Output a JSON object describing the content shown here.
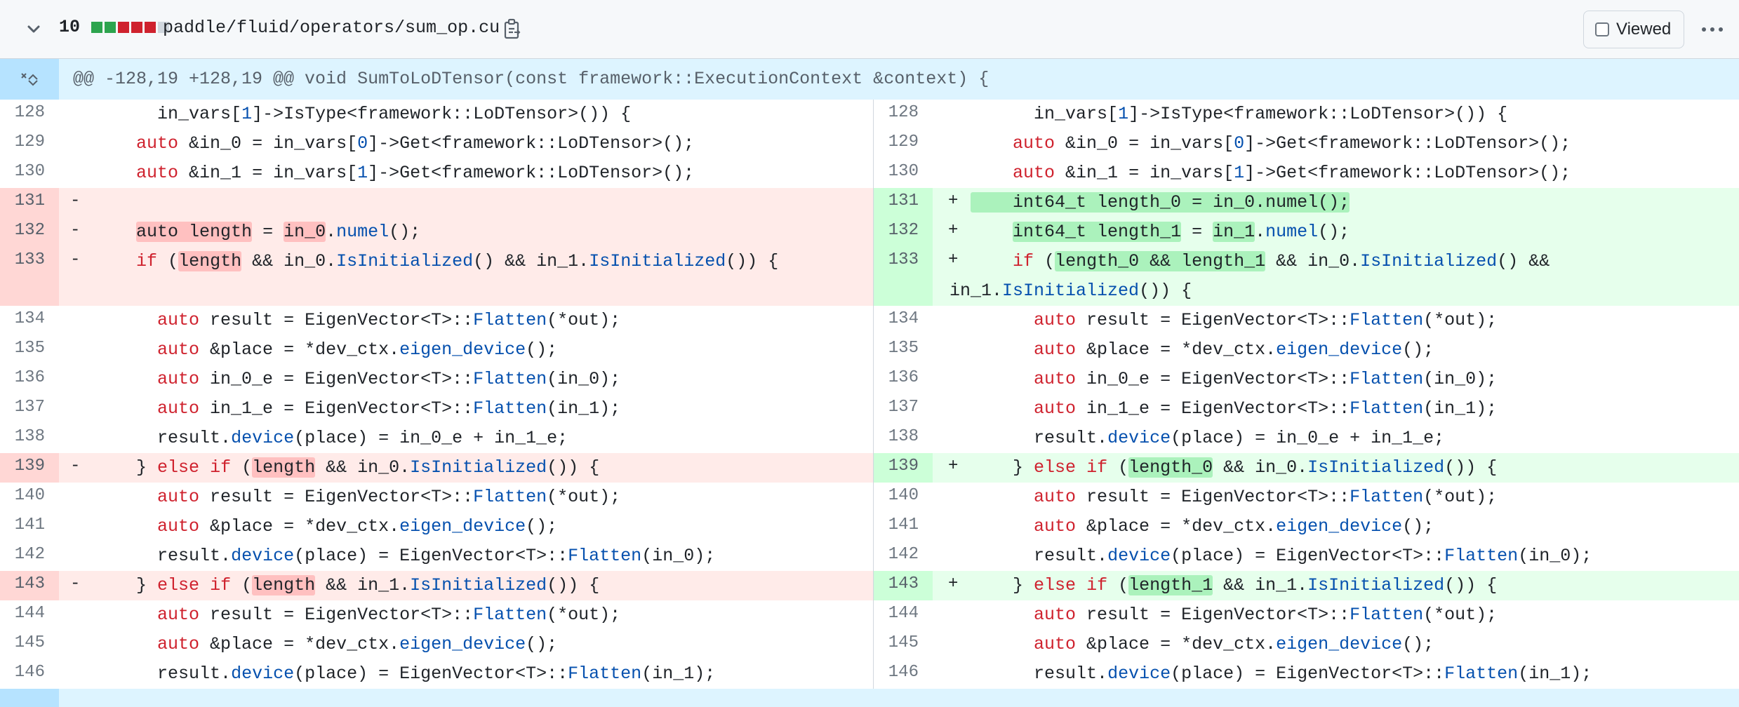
{
  "file": {
    "changes_count": "10",
    "path": "paddle/fluid/operators/sum_op.cu",
    "diffstat": [
      "#2da44e",
      "#2da44e",
      "#cf222e",
      "#cf222e",
      "#cf222e",
      "#d0d7de"
    ],
    "viewed_label": "Viewed"
  },
  "hunk": {
    "header": "@@ -128,19 +128,19 @@ void SumToLoDTensor(const framework::ExecutionContext &context) {"
  },
  "rows": [
    {
      "type": "ctx",
      "ln": "128",
      "rn": "128",
      "l": [
        [
          "      in_vars[",
          ""
        ],
        [
          "1",
          "nb"
        ],
        [
          "]->IsType<framework::LoDTensor>()) {",
          ""
        ]
      ],
      "r": [
        [
          "      in_vars[",
          ""
        ],
        [
          "1",
          "nb"
        ],
        [
          "]->IsType<framework::LoDTensor>()) {",
          ""
        ]
      ]
    },
    {
      "type": "ctx",
      "ln": "129",
      "rn": "129",
      "l": [
        [
          "    ",
          ""
        ],
        [
          "auto",
          "kw"
        ],
        [
          " &in_0 = in_vars[",
          ""
        ],
        [
          "0",
          "nb"
        ],
        [
          "]->Get<framework::LoDTensor>();",
          ""
        ]
      ],
      "r": [
        [
          "    ",
          ""
        ],
        [
          "auto",
          "kw"
        ],
        [
          " &in_0 = in_vars[",
          ""
        ],
        [
          "0",
          "nb"
        ],
        [
          "]->Get<framework::LoDTensor>();",
          ""
        ]
      ]
    },
    {
      "type": "ctx",
      "ln": "130",
      "rn": "130",
      "l": [
        [
          "    ",
          ""
        ],
        [
          "auto",
          "kw"
        ],
        [
          " &in_1 = in_vars[",
          ""
        ],
        [
          "1",
          "nb"
        ],
        [
          "]->Get<framework::LoDTensor>();",
          ""
        ]
      ],
      "r": [
        [
          "    ",
          ""
        ],
        [
          "auto",
          "kw"
        ],
        [
          " &in_1 = in_vars[",
          ""
        ],
        [
          "1",
          "nb"
        ],
        [
          "]->Get<framework::LoDTensor>();",
          ""
        ]
      ]
    },
    {
      "type": "chg",
      "ln": "131",
      "rn": "131",
      "lm": "-",
      "rm": "+",
      "l": [],
      "r": [
        [
          "",
          "hl-add-lead"
        ],
        [
          "    int64_t length_0 = in_0.numel();",
          "hl-add"
        ]
      ]
    },
    {
      "type": "chg",
      "ln": "132",
      "rn": "132",
      "lm": "-",
      "rm": "+",
      "l": [
        [
          "    ",
          ""
        ],
        [
          "auto length",
          "hl-del"
        ],
        [
          " = ",
          ""
        ],
        [
          "in_0",
          "hl-del"
        ],
        [
          ".",
          ""
        ],
        [
          "numel",
          "fn"
        ],
        [
          "();",
          ""
        ]
      ],
      "r": [
        [
          "    ",
          ""
        ],
        [
          "int64_t length_1",
          "hl-add"
        ],
        [
          " = ",
          ""
        ],
        [
          "in_1",
          "hl-add"
        ],
        [
          ".",
          ""
        ],
        [
          "numel",
          "fn"
        ],
        [
          "();",
          ""
        ]
      ]
    },
    {
      "type": "chg",
      "tall": true,
      "ln": "133",
      "rn": "133",
      "lm": "-",
      "rm": "+",
      "l": [
        [
          "    ",
          ""
        ],
        [
          "if",
          "kw"
        ],
        [
          " (",
          ""
        ],
        [
          "length",
          "hl-del"
        ],
        [
          " && in_0.",
          ""
        ],
        [
          "IsInitialized",
          "fn"
        ],
        [
          "() && in_1.",
          ""
        ],
        [
          "IsInitialized",
          "fn"
        ],
        [
          "()) {",
          ""
        ]
      ],
      "r": [
        [
          "    ",
          ""
        ],
        [
          "if",
          "kw"
        ],
        [
          " (",
          ""
        ],
        [
          "length_0 && length_1",
          "hl-add"
        ],
        [
          " && in_0.",
          ""
        ],
        [
          "IsInitialized",
          "fn"
        ],
        [
          "() && in_1.",
          ""
        ],
        [
          "IsInitialized",
          "fn"
        ],
        [
          "()) {",
          ""
        ]
      ]
    },
    {
      "type": "ctx",
      "ln": "134",
      "rn": "134",
      "l": [
        [
          "      ",
          ""
        ],
        [
          "auto",
          "kw"
        ],
        [
          " result = EigenVector<T>::",
          ""
        ],
        [
          "Flatten",
          "fn"
        ],
        [
          "(*out);",
          ""
        ]
      ],
      "r": [
        [
          "      ",
          ""
        ],
        [
          "auto",
          "kw"
        ],
        [
          " result = EigenVector<T>::",
          ""
        ],
        [
          "Flatten",
          "fn"
        ],
        [
          "(*out);",
          ""
        ]
      ]
    },
    {
      "type": "ctx",
      "ln": "135",
      "rn": "135",
      "l": [
        [
          "      ",
          ""
        ],
        [
          "auto",
          "kw"
        ],
        [
          " &place = *dev_ctx.",
          ""
        ],
        [
          "eigen_device",
          "fn"
        ],
        [
          "();",
          ""
        ]
      ],
      "r": [
        [
          "      ",
          ""
        ],
        [
          "auto",
          "kw"
        ],
        [
          " &place = *dev_ctx.",
          ""
        ],
        [
          "eigen_device",
          "fn"
        ],
        [
          "();",
          ""
        ]
      ]
    },
    {
      "type": "ctx",
      "ln": "136",
      "rn": "136",
      "l": [
        [
          "      ",
          ""
        ],
        [
          "auto",
          "kw"
        ],
        [
          " in_0_e = EigenVector<T>::",
          ""
        ],
        [
          "Flatten",
          "fn"
        ],
        [
          "(in_0);",
          ""
        ]
      ],
      "r": [
        [
          "      ",
          ""
        ],
        [
          "auto",
          "kw"
        ],
        [
          " in_0_e = EigenVector<T>::",
          ""
        ],
        [
          "Flatten",
          "fn"
        ],
        [
          "(in_0);",
          ""
        ]
      ]
    },
    {
      "type": "ctx",
      "ln": "137",
      "rn": "137",
      "l": [
        [
          "      ",
          ""
        ],
        [
          "auto",
          "kw"
        ],
        [
          " in_1_e = EigenVector<T>::",
          ""
        ],
        [
          "Flatten",
          "fn"
        ],
        [
          "(in_1);",
          ""
        ]
      ],
      "r": [
        [
          "      ",
          ""
        ],
        [
          "auto",
          "kw"
        ],
        [
          " in_1_e = EigenVector<T>::",
          ""
        ],
        [
          "Flatten",
          "fn"
        ],
        [
          "(in_1);",
          ""
        ]
      ]
    },
    {
      "type": "ctx",
      "ln": "138",
      "rn": "138",
      "l": [
        [
          "      result.",
          ""
        ],
        [
          "device",
          "fn"
        ],
        [
          "(place) = in_0_e + in_1_e;",
          ""
        ]
      ],
      "r": [
        [
          "      result.",
          ""
        ],
        [
          "device",
          "fn"
        ],
        [
          "(place) = in_0_e + in_1_e;",
          ""
        ]
      ]
    },
    {
      "type": "chg",
      "ln": "139",
      "rn": "139",
      "lm": "-",
      "rm": "+",
      "l": [
        [
          "    } ",
          ""
        ],
        [
          "else",
          "kw"
        ],
        [
          " ",
          ""
        ],
        [
          "if",
          "kw"
        ],
        [
          " (",
          ""
        ],
        [
          "length",
          "hl-del"
        ],
        [
          " && in_0.",
          ""
        ],
        [
          "IsInitialized",
          "fn"
        ],
        [
          "()) {",
          ""
        ]
      ],
      "r": [
        [
          "    } ",
          ""
        ],
        [
          "else",
          "kw"
        ],
        [
          " ",
          ""
        ],
        [
          "if",
          "kw"
        ],
        [
          " (",
          ""
        ],
        [
          "length_0",
          "hl-add"
        ],
        [
          " && in_0.",
          ""
        ],
        [
          "IsInitialized",
          "fn"
        ],
        [
          "()) {",
          ""
        ]
      ]
    },
    {
      "type": "ctx",
      "ln": "140",
      "rn": "140",
      "l": [
        [
          "      ",
          ""
        ],
        [
          "auto",
          "kw"
        ],
        [
          " result = EigenVector<T>::",
          ""
        ],
        [
          "Flatten",
          "fn"
        ],
        [
          "(*out);",
          ""
        ]
      ],
      "r": [
        [
          "      ",
          ""
        ],
        [
          "auto",
          "kw"
        ],
        [
          " result = EigenVector<T>::",
          ""
        ],
        [
          "Flatten",
          "fn"
        ],
        [
          "(*out);",
          ""
        ]
      ]
    },
    {
      "type": "ctx",
      "ln": "141",
      "rn": "141",
      "l": [
        [
          "      ",
          ""
        ],
        [
          "auto",
          "kw"
        ],
        [
          " &place = *dev_ctx.",
          ""
        ],
        [
          "eigen_device",
          "fn"
        ],
        [
          "();",
          ""
        ]
      ],
      "r": [
        [
          "      ",
          ""
        ],
        [
          "auto",
          "kw"
        ],
        [
          " &place = *dev_ctx.",
          ""
        ],
        [
          "eigen_device",
          "fn"
        ],
        [
          "();",
          ""
        ]
      ]
    },
    {
      "type": "ctx",
      "ln": "142",
      "rn": "142",
      "l": [
        [
          "      result.",
          ""
        ],
        [
          "device",
          "fn"
        ],
        [
          "(place) = EigenVector<T>::",
          ""
        ],
        [
          "Flatten",
          "fn"
        ],
        [
          "(in_0);",
          ""
        ]
      ],
      "r": [
        [
          "      result.",
          ""
        ],
        [
          "device",
          "fn"
        ],
        [
          "(place) = EigenVector<T>::",
          ""
        ],
        [
          "Flatten",
          "fn"
        ],
        [
          "(in_0);",
          ""
        ]
      ]
    },
    {
      "type": "chg",
      "ln": "143",
      "rn": "143",
      "lm": "-",
      "rm": "+",
      "l": [
        [
          "    } ",
          ""
        ],
        [
          "else",
          "kw"
        ],
        [
          " ",
          ""
        ],
        [
          "if",
          "kw"
        ],
        [
          " (",
          ""
        ],
        [
          "length",
          "hl-del"
        ],
        [
          " && in_1.",
          ""
        ],
        [
          "IsInitialized",
          "fn"
        ],
        [
          "()) {",
          ""
        ]
      ],
      "r": [
        [
          "    } ",
          ""
        ],
        [
          "else",
          "kw"
        ],
        [
          " ",
          ""
        ],
        [
          "if",
          "kw"
        ],
        [
          " (",
          ""
        ],
        [
          "length_1",
          "hl-add"
        ],
        [
          " && in_1.",
          ""
        ],
        [
          "IsInitialized",
          "fn"
        ],
        [
          "()) {",
          ""
        ]
      ]
    },
    {
      "type": "ctx",
      "ln": "144",
      "rn": "144",
      "l": [
        [
          "      ",
          ""
        ],
        [
          "auto",
          "kw"
        ],
        [
          " result = EigenVector<T>::",
          ""
        ],
        [
          "Flatten",
          "fn"
        ],
        [
          "(*out);",
          ""
        ]
      ],
      "r": [
        [
          "      ",
          ""
        ],
        [
          "auto",
          "kw"
        ],
        [
          " result = EigenVector<T>::",
          ""
        ],
        [
          "Flatten",
          "fn"
        ],
        [
          "(*out);",
          ""
        ]
      ]
    },
    {
      "type": "ctx",
      "ln": "145",
      "rn": "145",
      "l": [
        [
          "      ",
          ""
        ],
        [
          "auto",
          "kw"
        ],
        [
          " &place = *dev_ctx.",
          ""
        ],
        [
          "eigen_device",
          "fn"
        ],
        [
          "();",
          ""
        ]
      ],
      "r": [
        [
          "      ",
          ""
        ],
        [
          "auto",
          "kw"
        ],
        [
          " &place = *dev_ctx.",
          ""
        ],
        [
          "eigen_device",
          "fn"
        ],
        [
          "();",
          ""
        ]
      ]
    },
    {
      "type": "ctx",
      "ln": "146",
      "rn": "146",
      "l": [
        [
          "      result.",
          ""
        ],
        [
          "device",
          "fn"
        ],
        [
          "(place) = EigenVector<T>::",
          ""
        ],
        [
          "Flatten",
          "fn"
        ],
        [
          "(in_1);",
          ""
        ]
      ],
      "r": [
        [
          "      result.",
          ""
        ],
        [
          "device",
          "fn"
        ],
        [
          "(place) = EigenVector<T>::",
          ""
        ],
        [
          "Flatten",
          "fn"
        ],
        [
          "(in_1);",
          ""
        ]
      ]
    }
  ]
}
